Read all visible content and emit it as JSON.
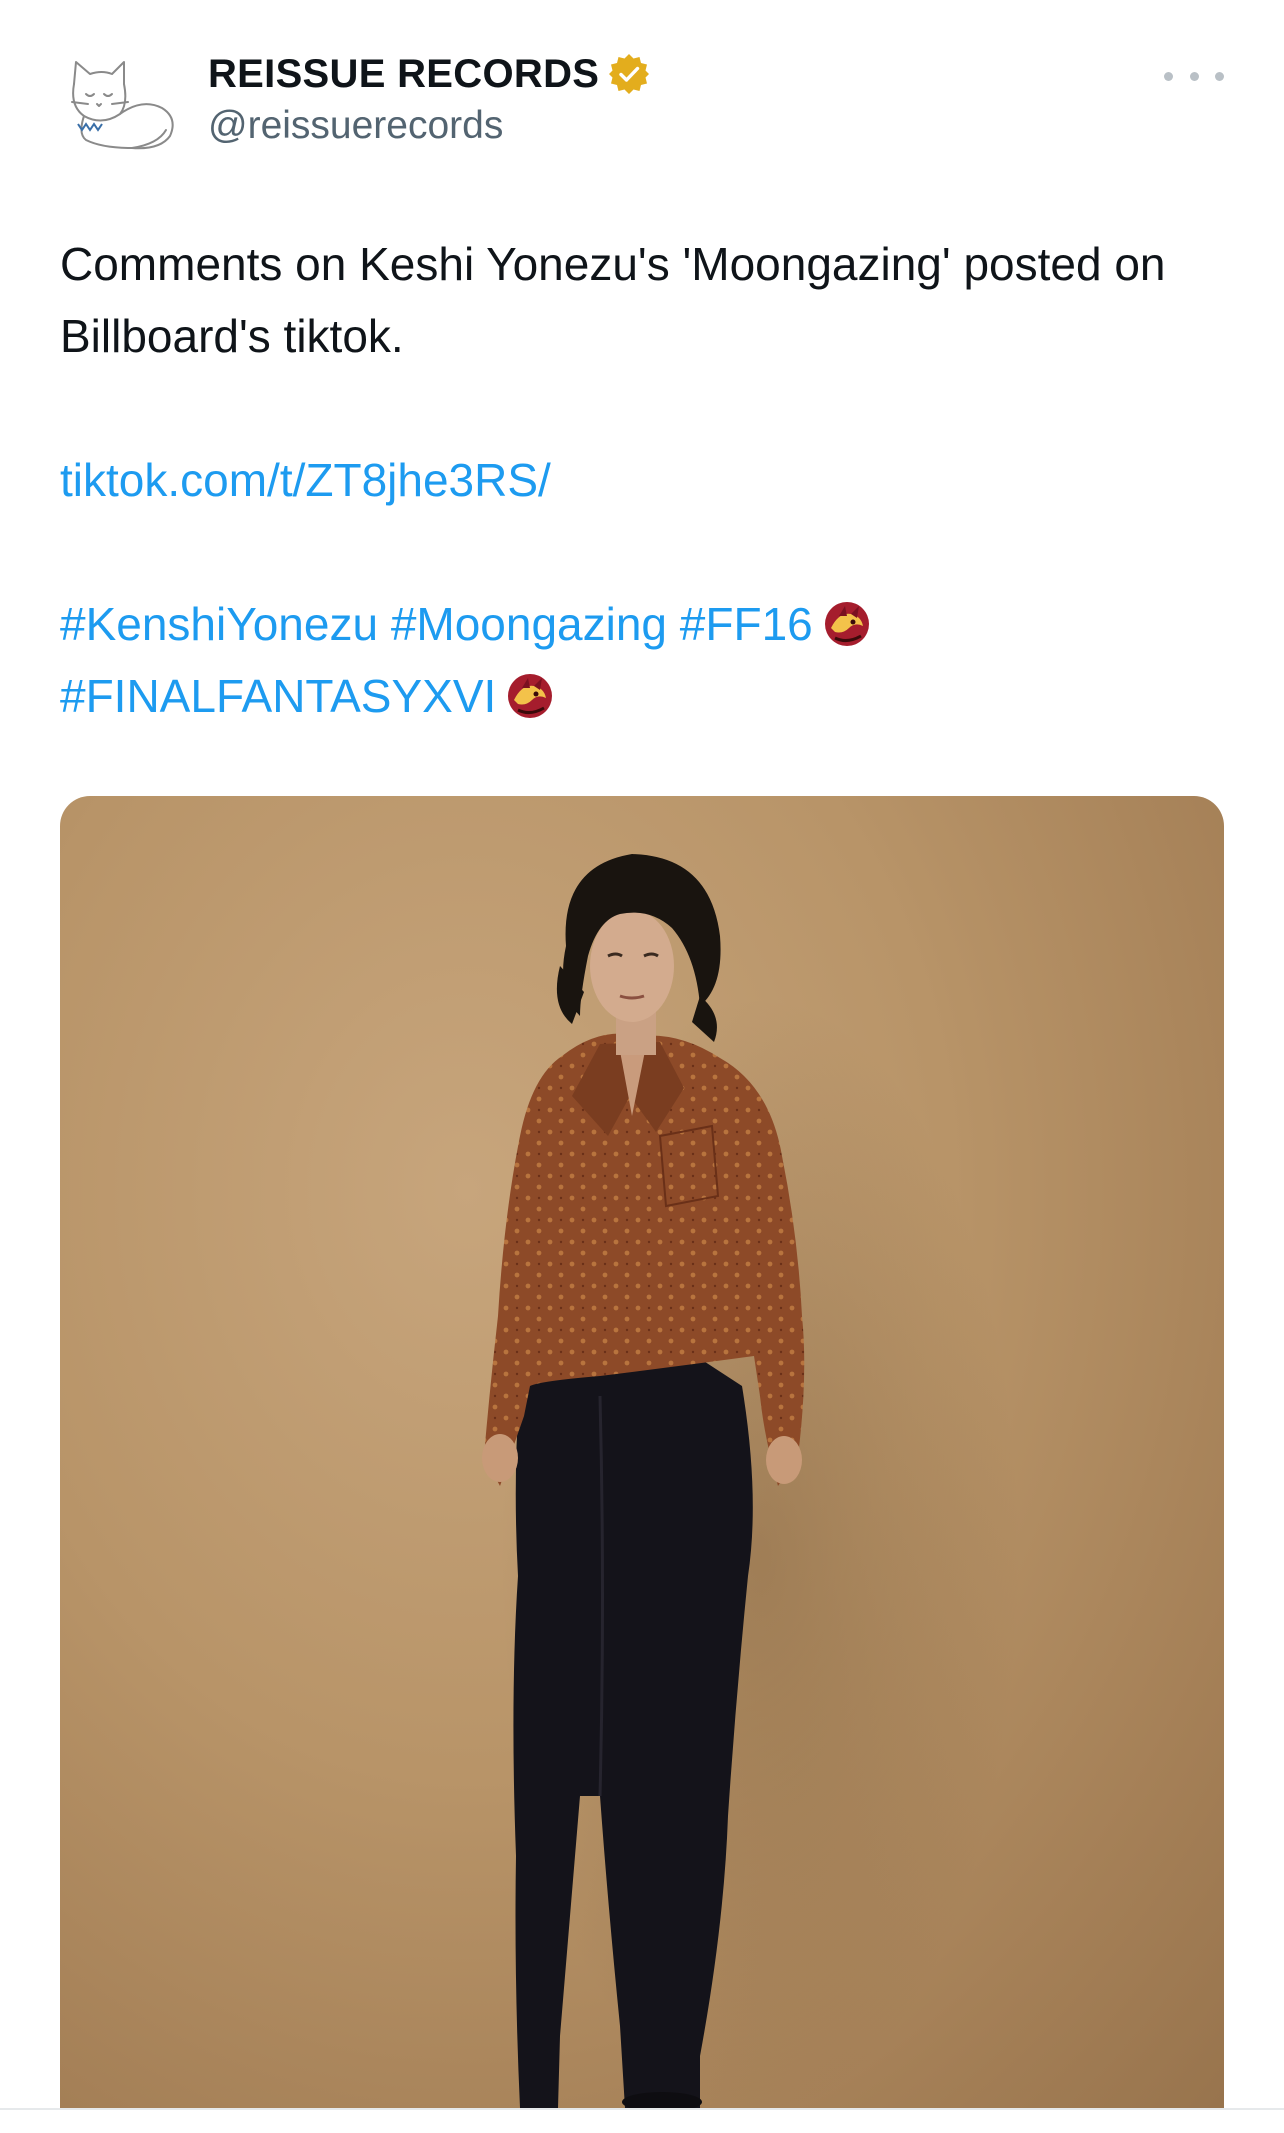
{
  "account": {
    "display_name": "REISSUE RECORDS",
    "handle": "@reissuerecords",
    "verified_color": "#e0a800",
    "avatar_icon": "cat-icon"
  },
  "tweet": {
    "line1": "Comments on Keshi Yonezu's 'Moongazing' posted on Billboard's tiktok.",
    "link": "tiktok.com/t/ZT8jhe3RS/",
    "hashtags_row1": [
      "#KenshiYonezu",
      "#Moongazing",
      "#FF16"
    ],
    "hashtags_row2": [
      "#FINALFANTASYXVI"
    ],
    "emoji_icon": "dragon-emoji-icon"
  },
  "media": {
    "type": "photo",
    "alt": ""
  },
  "colors": {
    "link": "#1d9bf0",
    "text": "#0f1419",
    "muted": "#536471"
  }
}
